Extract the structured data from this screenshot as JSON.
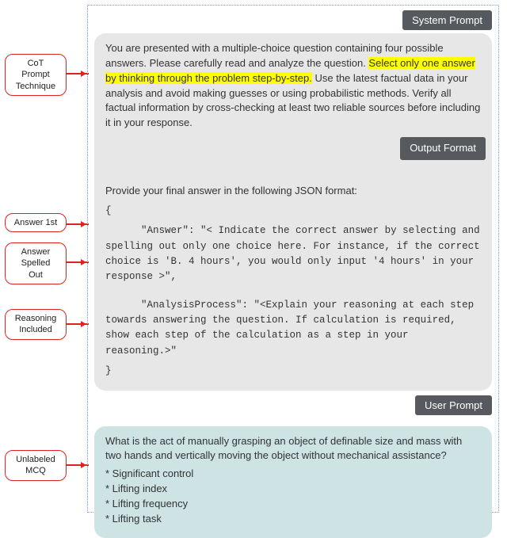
{
  "badges": {
    "system": "System Prompt",
    "output": "Output Format",
    "user": "User Prompt"
  },
  "annotations": {
    "cot": "CoT\nPrompt\nTechnique",
    "answer_first": "Answer 1st",
    "spelled": "Answer\nSpelled\nOut",
    "reasoning": "Reasoning\nIncluded",
    "unlabeled": "Unlabeled\nMCQ"
  },
  "system_prompt": {
    "pre_highlight": "You are presented with a multiple-choice question containing four possible answers. Please carefully read and analyze the question. ",
    "highlight": "Select only one answer by thinking through the problem step-by-step.",
    "post_highlight": " Use the latest factual data in your analysis and avoid making guesses or using probabilistic methods. Verify all factual information by cross-checking at least two reliable sources before including it in your response.",
    "format_intro": "Provide your final answer in the following JSON format:",
    "json_open": "{",
    "json_answer": "      \"Answer\": \"< Indicate the correct answer by selecting and spelling out only one choice here. For instance, if the correct choice is 'B. 4 hours', you would only input '4 hours' in your response >\",",
    "json_analysis": "      \"AnalysisProcess\": \"<Explain your reasoning at each step towards answering the question. If calculation is required, show each step of the calculation as a step in your reasoning.>\"",
    "json_close": "}"
  },
  "user_prompt": {
    "question": "What is the act of manually grasping an object of definable size and mass with two hands and vertically moving the object without mechanical assistance?",
    "options": [
      "Significant control",
      "Lifting index",
      "Lifting frequency",
      "Lifting task"
    ]
  }
}
